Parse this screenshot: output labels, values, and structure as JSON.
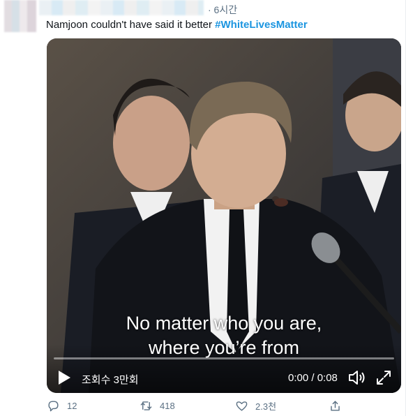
{
  "tweet": {
    "time": "· 6시간",
    "text": "Namjoon couldn't have said it better ",
    "hashtag": "#WhiteLivesMatter"
  },
  "video": {
    "caption_line1": "No matter who you are,",
    "caption_line2": "where you’re from",
    "views": "조회수 3만회",
    "time": "0:00 / 0:08",
    "progress": 0.0
  },
  "actions": {
    "replies": "12",
    "retweets": "418",
    "likes": "2.3천"
  },
  "icons": [
    "play-icon",
    "volume-icon",
    "fullscreen-icon",
    "reply-icon",
    "retweet-icon",
    "like-icon",
    "share-icon"
  ],
  "colors": {
    "accent": "#1b95e0",
    "muted": "#5b7083"
  }
}
